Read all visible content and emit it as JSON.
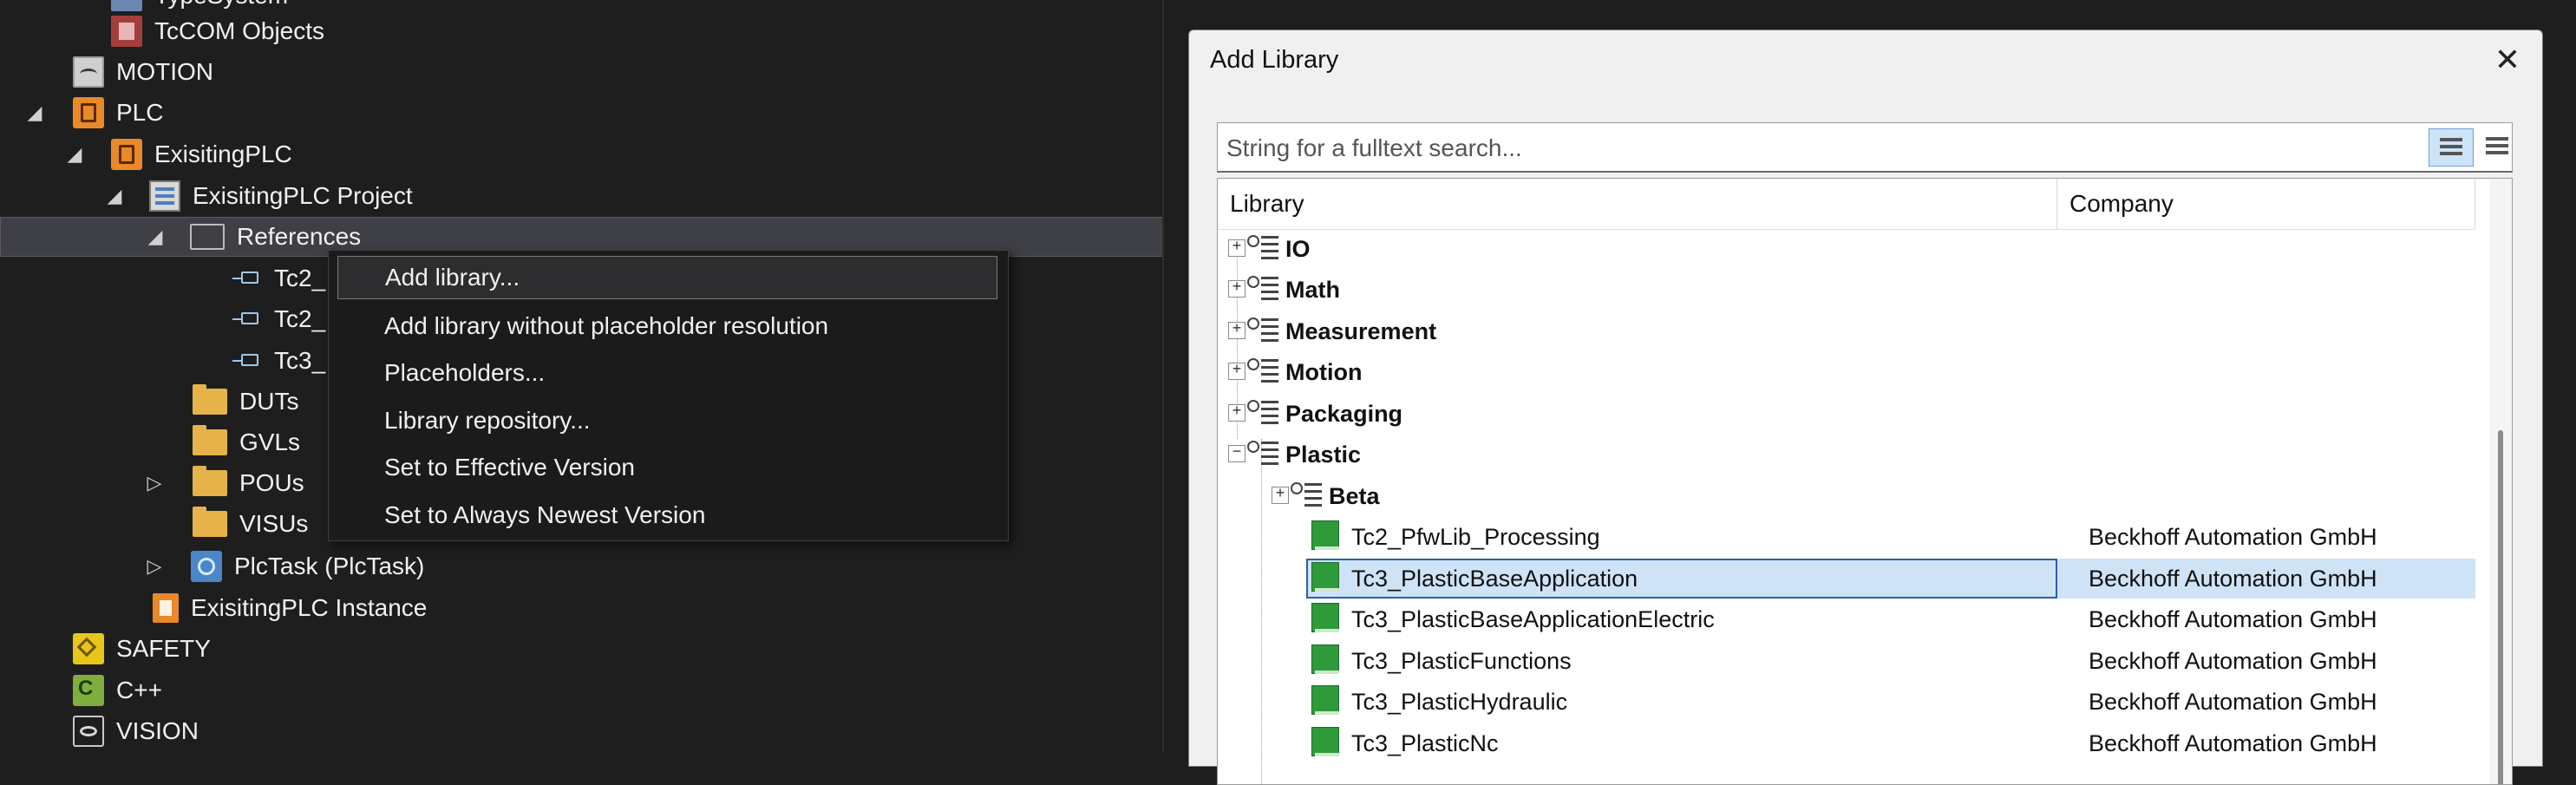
{
  "tree": {
    "items": [
      {
        "label": "TypeSystem",
        "icon": "type-system-icon"
      },
      {
        "label": "TcCOM Objects",
        "icon": "tccom-objects-icon"
      },
      {
        "label": "MOTION",
        "icon": "motion-icon"
      },
      {
        "label": "PLC",
        "icon": "plc-icon",
        "expander": "◢"
      },
      {
        "label": "ExisitingPLC",
        "icon": "plc-project-icon",
        "expander": "◢"
      },
      {
        "label": "ExisitingPLC Project",
        "icon": "plc-project-file-icon",
        "expander": "◢"
      },
      {
        "label": "References",
        "icon": "references-folder-icon",
        "expander": "◢"
      },
      {
        "label": "Tc2_",
        "icon": "library-reference-icon"
      },
      {
        "label": "Tc2_",
        "icon": "library-reference-icon"
      },
      {
        "label": "Tc3_",
        "icon": "library-reference-icon"
      },
      {
        "label": "DUTs",
        "icon": "folder-icon"
      },
      {
        "label": "GVLs",
        "icon": "folder-icon"
      },
      {
        "label": "POUs",
        "icon": "folder-icon",
        "expander": "▷"
      },
      {
        "label": "VISUs",
        "icon": "folder-icon"
      },
      {
        "label": "PlcTask (PlcTask)",
        "icon": "plc-task-icon",
        "expander": "▷"
      },
      {
        "label": "ExisitingPLC Instance",
        "icon": "plc-instance-icon"
      },
      {
        "label": "SAFETY",
        "icon": "safety-icon"
      },
      {
        "label": "C++",
        "icon": "cpp-icon"
      },
      {
        "label": "VISION",
        "icon": "vision-icon"
      }
    ]
  },
  "context_menu": {
    "items": [
      {
        "label": "Add library..."
      },
      {
        "label": "Add library without placeholder resolution"
      },
      {
        "label": "Placeholders..."
      },
      {
        "label": "Library repository..."
      },
      {
        "label": "Set to Effective Version"
      },
      {
        "label": "Set to Always Newest Version"
      }
    ]
  },
  "dialog": {
    "title": "Add Library",
    "close_glyph": "✕",
    "search": {
      "placeholder": "String for a fulltext search...",
      "value": ""
    },
    "columns": {
      "library": "Library",
      "company": "Company"
    },
    "categories": [
      {
        "name": "IO",
        "expander": "+"
      },
      {
        "name": "Math",
        "expander": "+"
      },
      {
        "name": "Measurement",
        "expander": "+"
      },
      {
        "name": "Motion",
        "expander": "+"
      },
      {
        "name": "Packaging",
        "expander": "+"
      },
      {
        "name": "Plastic",
        "expander": "−"
      },
      {
        "name": "Beta",
        "expander": "+"
      }
    ],
    "libraries": [
      {
        "name": "Tc2_PfwLib_Processing",
        "company": "Beckhoff Automation GmbH",
        "selected": false
      },
      {
        "name": "Tc3_PlasticBaseApplication",
        "company": "Beckhoff Automation GmbH",
        "selected": true
      },
      {
        "name": "Tc3_PlasticBaseApplicationElectric",
        "company": "Beckhoff Automation GmbH",
        "selected": false
      },
      {
        "name": "Tc3_PlasticFunctions",
        "company": "Beckhoff Automation GmbH",
        "selected": false
      },
      {
        "name": "Tc3_PlasticHydraulic",
        "company": "Beckhoff Automation GmbH",
        "selected": false
      },
      {
        "name": "Tc3_PlasticNc",
        "company": "Beckhoff Automation GmbH",
        "selected": false
      }
    ]
  },
  "colors": {
    "selection": "#cfe3f7",
    "selection_border": "#2a5fa8",
    "dark_bg": "#1e1e1e",
    "library_icon": "#2f9a3a"
  }
}
